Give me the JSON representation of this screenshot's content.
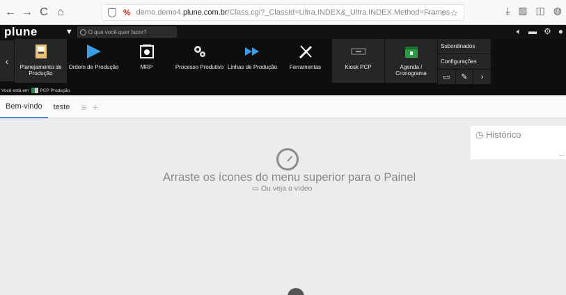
{
  "browser": {
    "url_host_pre": "demo.demo4.",
    "url_host_bold": "plune.com.br",
    "url_path": "/Class.cgi?_ClassId=Ultra.INDEX&_Ultra.INDEX.Method=Frames"
  },
  "app": {
    "brand": "plune",
    "search_placeholder": "O que você quer fazer?"
  },
  "ribbon": {
    "items": [
      {
        "label": "Planejamento de Produção",
        "icon": "planning-icon"
      },
      {
        "label": "Ordem de Produção",
        "icon": "play-icon"
      },
      {
        "label": "MRP",
        "icon": "mrp-icon"
      },
      {
        "label": "Processo Produtivo",
        "icon": "gears-icon"
      },
      {
        "label": "Linhas de Produção",
        "icon": "fast-forward-icon"
      },
      {
        "label": "Ferramentas",
        "icon": "tools-icon"
      },
      {
        "label": "Kiosk PCP",
        "icon": "kiosk-icon"
      },
      {
        "label": "Agenda / Cronograma",
        "icon": "calendar-icon"
      }
    ],
    "side": {
      "subordinados": "Subordinados",
      "configuracoes": "Configurações"
    }
  },
  "breadcrumb": {
    "prefix": "Você está em",
    "location": "PCP Produção"
  },
  "tabs": [
    "Bem-vindo",
    "teste"
  ],
  "content": {
    "message": "Arraste os ícones do menu superior para o Painel",
    "video_link": "Ou veja o vídeo",
    "historico": "Histórico",
    "historico_more": "..."
  },
  "colors": {
    "accent": "#4a8ad4",
    "ribbon_bg": "#0e0e0e"
  }
}
